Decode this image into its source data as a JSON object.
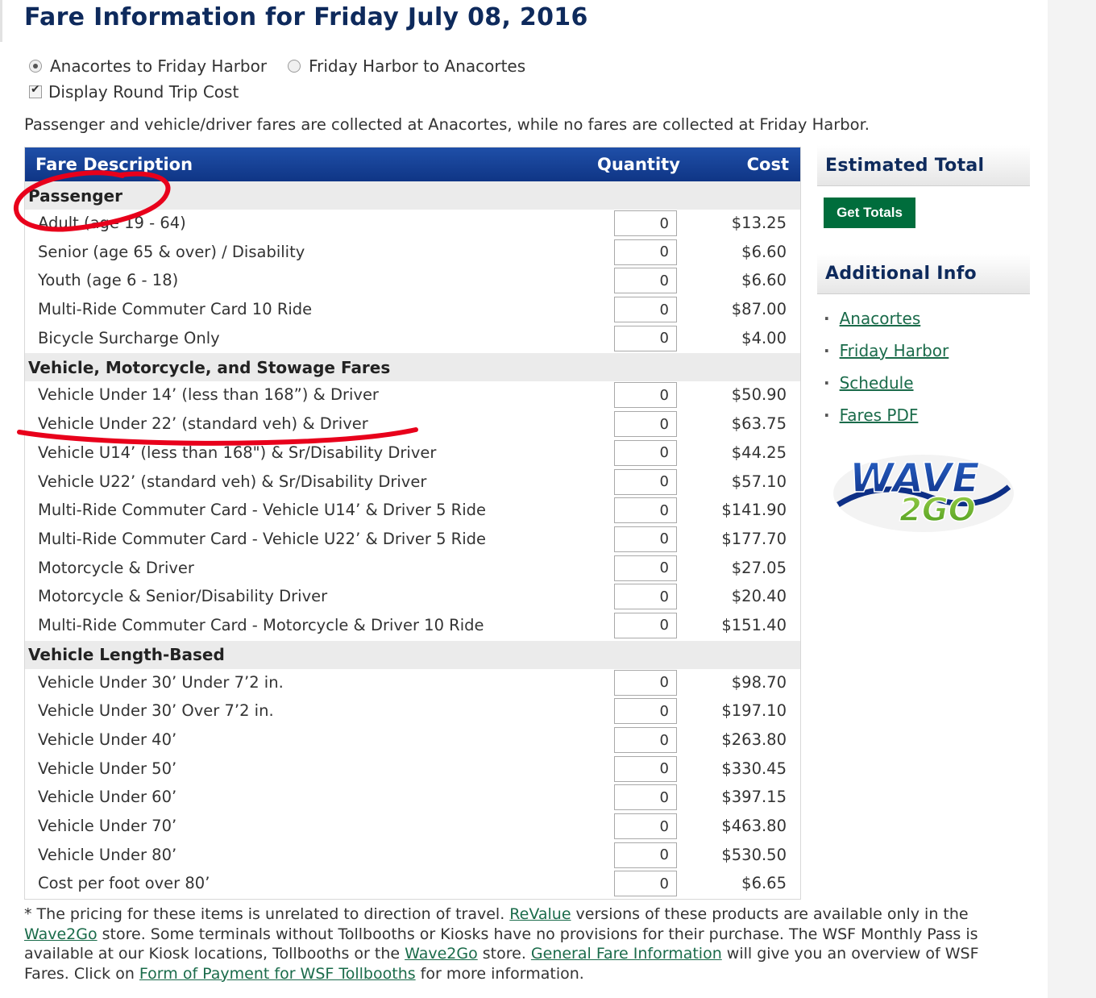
{
  "page": {
    "title": "Fare Information for Friday July 08, 2016",
    "direction_options": [
      {
        "label": "Anacortes to Friday Harbor",
        "selected": true
      },
      {
        "label": "Friday Harbor to Anacortes",
        "selected": false
      }
    ],
    "round_trip": {
      "label": "Display Round Trip Cost",
      "checked": true
    },
    "collection_note": "Passenger and vehicle/driver fares are collected at Anacortes, while no fares are collected at Friday Harbor."
  },
  "fare_table": {
    "headers": {
      "description": "Fare Description",
      "quantity": "Quantity",
      "cost": "Cost"
    },
    "sections": [
      {
        "title": "Passenger",
        "rows": [
          {
            "description": "Adult (age 19 - 64)",
            "quantity": "0",
            "cost": "$13.25"
          },
          {
            "description": "Senior (age 65 & over) / Disability",
            "quantity": "0",
            "cost": "$6.60"
          },
          {
            "description": "Youth (age 6 - 18)",
            "quantity": "0",
            "cost": "$6.60"
          },
          {
            "description": "Multi-Ride Commuter Card 10 Ride",
            "quantity": "0",
            "cost": "$87.00"
          },
          {
            "description": "Bicycle Surcharge Only",
            "quantity": "0",
            "cost": "$4.00"
          }
        ]
      },
      {
        "title": "Vehicle, Motorcycle, and Stowage Fares",
        "rows": [
          {
            "description": "Vehicle Under 14’ (less than 168”) & Driver",
            "quantity": "0",
            "cost": "$50.90"
          },
          {
            "description": "Vehicle Under 22’ (standard veh) & Driver",
            "quantity": "0",
            "cost": "$63.75"
          },
          {
            "description": "Vehicle U14’ (less than 168\") & Sr/Disability Driver",
            "quantity": "0",
            "cost": "$44.25"
          },
          {
            "description": "Vehicle U22’ (standard veh) & Sr/Disability Driver",
            "quantity": "0",
            "cost": "$57.10"
          },
          {
            "description": "Multi-Ride Commuter Card - Vehicle U14’ & Driver 5 Ride",
            "quantity": "0",
            "cost": "$141.90"
          },
          {
            "description": "Multi-Ride Commuter Card - Vehicle U22’ & Driver 5 Ride",
            "quantity": "0",
            "cost": "$177.70"
          },
          {
            "description": "Motorcycle & Driver",
            "quantity": "0",
            "cost": "$27.05"
          },
          {
            "description": "Motorcycle & Senior/Disability Driver",
            "quantity": "0",
            "cost": "$20.40"
          },
          {
            "description": "Multi-Ride Commuter Card - Motorcycle & Driver 10 Ride",
            "quantity": "0",
            "cost": "$151.40"
          }
        ]
      },
      {
        "title": "Vehicle Length-Based",
        "rows": [
          {
            "description": "Vehicle Under 30’ Under 7’2 in.",
            "quantity": "0",
            "cost": "$98.70"
          },
          {
            "description": "Vehicle Under 30’ Over 7’2 in.",
            "quantity": "0",
            "cost": "$197.10"
          },
          {
            "description": "Vehicle Under 40’",
            "quantity": "0",
            "cost": "$263.80"
          },
          {
            "description": "Vehicle Under 50’",
            "quantity": "0",
            "cost": "$330.45"
          },
          {
            "description": "Vehicle Under 60’",
            "quantity": "0",
            "cost": "$397.15"
          },
          {
            "description": "Vehicle Under 70’",
            "quantity": "0",
            "cost": "$463.80"
          },
          {
            "description": "Vehicle Under 80’",
            "quantity": "0",
            "cost": "$530.50"
          },
          {
            "description": "Cost per foot over 80’",
            "quantity": "0",
            "cost": "$6.65"
          }
        ]
      }
    ]
  },
  "sidebar": {
    "estimated_total_heading": "Estimated Total",
    "get_totals_label": "Get Totals",
    "additional_info_heading": "Additional Info",
    "links": [
      "Anacortes",
      "Friday Harbor",
      "Schedule",
      "Fares PDF"
    ],
    "logo_text_top": "WAVE",
    "logo_text_bottom": "2GO"
  },
  "footnote": {
    "t1": "* The pricing for these items is unrelated to direction of travel. ",
    "l1": "ReValue",
    "t2": " versions of these products are available only in the ",
    "l2": "Wave2Go",
    "t3": " store. Some terminals without Tollbooths or Kiosks have no provisions for their purchase. The WSF Monthly Pass is available at our Kiosk locations, Tollbooths or the ",
    "l3": "Wave2Go",
    "t4": " store. ",
    "l4": "General Fare Information",
    "t5": " will give you an overview of WSF Fares. Click on ",
    "l5": "Form of Payment for WSF Tollbooths",
    "t6": " for more information."
  },
  "colors": {
    "header_blue": "#1a45a0",
    "title_navy": "#0e2a5c",
    "button_green": "#006d3c",
    "link_green": "#1a6b4a",
    "annotation_red": "#e8001b"
  }
}
